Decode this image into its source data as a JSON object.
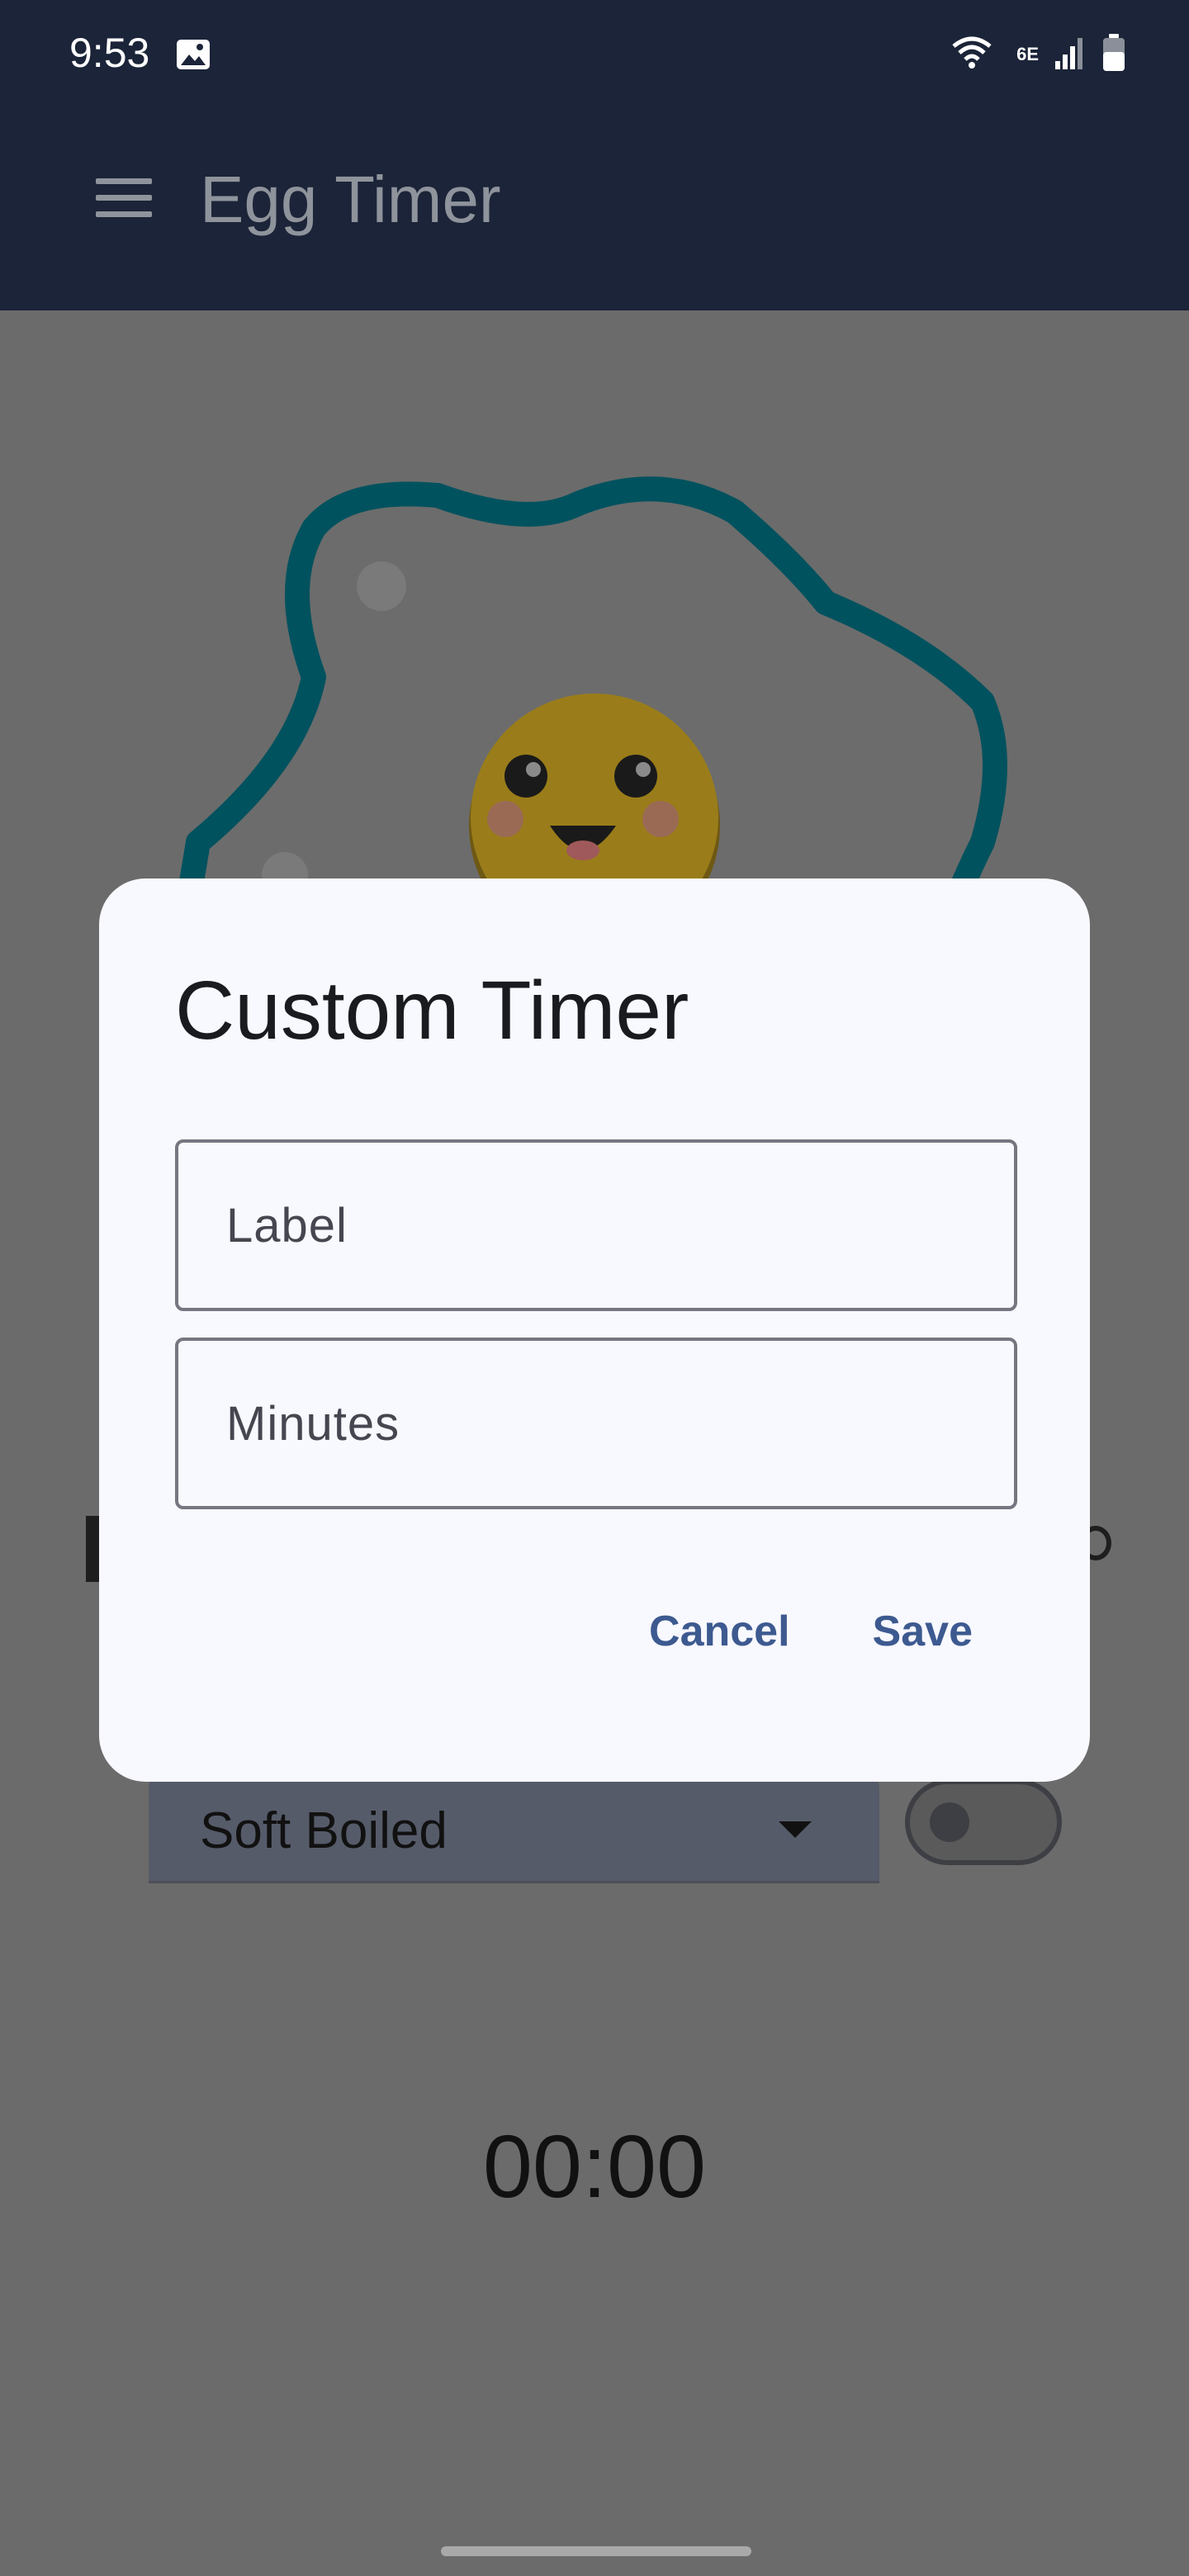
{
  "status_bar": {
    "time": "9:53",
    "network_label": "6E",
    "icons": [
      "gallery-icon",
      "wifi-icon",
      "signal-icon",
      "battery-icon"
    ]
  },
  "app_bar": {
    "title": "Egg Timer",
    "menu_icon": "menu-icon"
  },
  "background": {
    "egg_type_selected": "Soft Boiled",
    "alarm_toggle_on": false,
    "timer": "00:00"
  },
  "dialog": {
    "title": "Custom Timer",
    "label_field": {
      "value": "",
      "placeholder": "Label"
    },
    "minutes_field": {
      "value": "",
      "placeholder": "Minutes"
    },
    "cancel_label": "Cancel",
    "save_label": "Save"
  },
  "colors": {
    "app_bar": "#1b2438",
    "scrim": "#6b6b6b",
    "dialog_surface": "#f8f8ff",
    "action_text": "#3d5a90",
    "egg_outline": "#00525e",
    "yolk": "#c9a227"
  }
}
